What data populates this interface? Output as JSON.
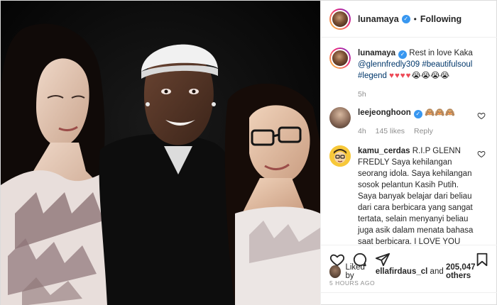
{
  "post": {
    "username": "lunamaya",
    "follow_status": "Following"
  },
  "caption": {
    "username": "lunamaya",
    "text": "Rest in love Kaka",
    "mention": "@glennfredly309",
    "tags": "#beautifulsoul #legend",
    "hearts": "♥♥♥♥",
    "emoji_tail": "😭😭😭😭",
    "time": "5h"
  },
  "comments": [
    {
      "username": "leejeonghoon",
      "text": "🙈🙈🙈",
      "time": "4h",
      "likes": "145 likes",
      "reply": "Reply"
    },
    {
      "username": "kamu_cerdas",
      "text": "R.I.P GLENN FREDLY Saya kehilangan seorang idola. Saya kehilangan sosok pelantun Kasih Putih. Saya banyak belajar dari beliau dari cara berbicara yang sangat tertata, selain menyanyi beliau juga asik dalam menata bahasa saat berbicara. I LOVE YOU BUNG 😭"
    }
  ],
  "likes": {
    "prefix": "Liked by",
    "user": "ellafirdaus_cl",
    "mid": "and",
    "count": "205,047 others"
  },
  "timestamp": "5 HOURS AGO",
  "icons": {
    "verified": "verified-badge-icon",
    "like": "heart-icon",
    "comment": "comment-icon",
    "share": "share-icon",
    "save": "bookmark-icon"
  },
  "colors": {
    "verified": "#3897f0",
    "link": "#00376b",
    "muted": "#8e8e8e",
    "hearts": "#ed4956"
  }
}
